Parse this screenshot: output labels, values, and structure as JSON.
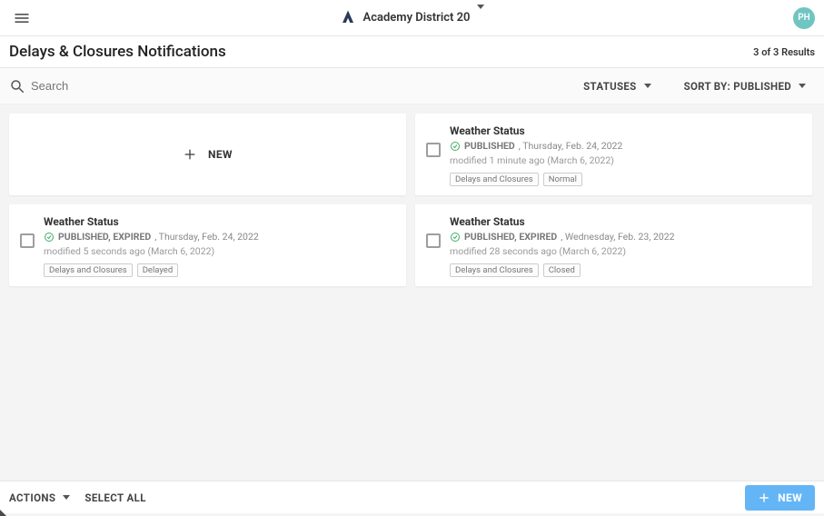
{
  "header": {
    "org_name": "Academy District 20",
    "avatar_initials": "PH"
  },
  "page": {
    "title": "Delays & Closures Notifications",
    "results_text": "3 of 3 Results"
  },
  "toolbar": {
    "search_placeholder": "Search",
    "statuses_label": "STATUSES",
    "sort_label": "SORT BY: PUBLISHED"
  },
  "new_card": {
    "label": "NEW"
  },
  "items": [
    {
      "title": "Weather Status",
      "status": "PUBLISHED",
      "date": ", Thursday, Feb. 24, 2022",
      "modified": "modified 1 minute ago (March 6, 2022)",
      "tag1": "Delays and Closures",
      "tag2": "Normal"
    },
    {
      "title": "Weather Status",
      "status": "PUBLISHED, EXPIRED",
      "date": ", Thursday, Feb. 24, 2022",
      "modified": "modified 5 seconds ago (March 6, 2022)",
      "tag1": "Delays and Closures",
      "tag2": "Delayed"
    },
    {
      "title": "Weather Status",
      "status": "PUBLISHED, EXPIRED",
      "date": ", Wednesday, Feb. 23, 2022",
      "modified": "modified 28 seconds ago (March 6, 2022)",
      "tag1": "Delays and Closures",
      "tag2": "Closed"
    }
  ],
  "bottombar": {
    "actions_label": "ACTIONS",
    "select_all_label": "SELECT ALL",
    "new_label": "NEW"
  }
}
